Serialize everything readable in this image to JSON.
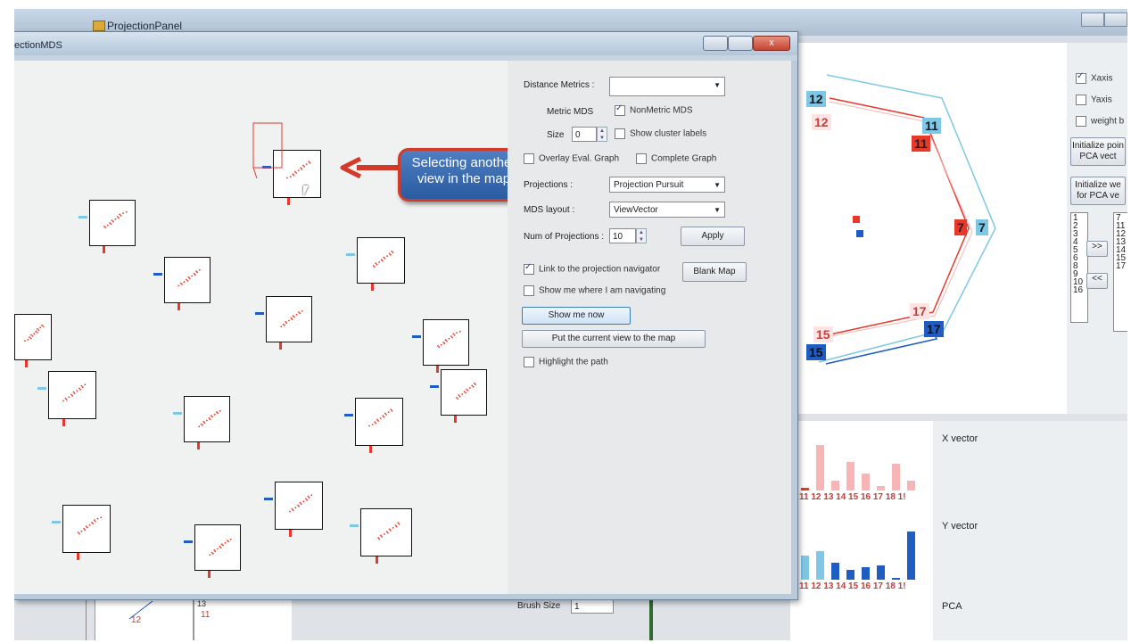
{
  "background_window": {
    "title": "ProjectionPanel"
  },
  "window": {
    "title": "ectionMDS",
    "close_glyph": "x"
  },
  "callout": {
    "text": "Selecting another view in the map"
  },
  "side_panel": {
    "distance_metrics_label": "Distance Metrics :",
    "distance_metrics_value": "",
    "metric_mds_label": "Metric MDS",
    "nonmetric_mds_label": "NonMetric MDS",
    "nonmetric_mds_checked": true,
    "size_label": "Size",
    "size_value": "0",
    "show_cluster_labels_label": "Show cluster labels",
    "overlay_eval_graph_label": "Overlay Eval. Graph",
    "complete_graph_label": "Complete Graph",
    "projections_label": "Projections :",
    "projections_value": "Projection Pursuit",
    "mds_layout_label": "MDS layout :",
    "mds_layout_value": "ViewVector",
    "num_projections_label": "Num of Projections :",
    "num_projections_value": "10",
    "apply_label": "Apply",
    "link_navigator_label": "Link to the projection navigator",
    "link_navigator_checked": true,
    "blank_map_label": "Blank Map",
    "show_me_where_label": "Show me where I am navigating",
    "show_me_now_label": "Show me now",
    "put_current_view_label": "Put the current view to the map",
    "highlight_path_label": "Highlight the path"
  },
  "navigator": {
    "xaxis_label": "Xaxis",
    "xaxis_checked": true,
    "yaxis_label": "Yaxis",
    "weight_label": "weight b",
    "init_points_label": "Initialize poin PCA vect",
    "init_weights_label": "Initialize we for PCA ve",
    "move_right_label": ">>",
    "move_left_label": "<<",
    "left_list": [
      "1",
      "2",
      "3",
      "4",
      "5",
      "6",
      "8",
      "9",
      "10",
      "16"
    ],
    "right_list": [
      "7",
      "11",
      "12",
      "13",
      "14",
      "15",
      "17"
    ],
    "node_labels": {
      "light_12": "12",
      "red_12": "12",
      "light_11": "11",
      "red_11": "11",
      "red_7": "7",
      "light_7": "7",
      "red_17": "17",
      "blue_17": "17",
      "red_15": "15",
      "blue_15": "15"
    }
  },
  "vectors": {
    "x_vector_label": "X vector",
    "y_vector_label": "Y vector",
    "pca_label": "PCA",
    "x_axis_ticks": "11 12 13 14 15 16 17 18 1!",
    "y_axis_ticks": "11 12 13 14 15 16 17 18 1!",
    "x_bars": [
      0.05,
      0.95,
      0.2,
      0.6,
      0.35,
      0.1,
      0.55,
      0.2
    ],
    "y_bars": [
      0.5,
      0.6,
      0.35,
      0.2,
      0.25,
      0.3,
      0.0,
      1.0
    ]
  },
  "bottom_strip": {
    "brush_size_label": "Brush Size",
    "brush_size_value": "1",
    "bottom_12": "12",
    "bottom_11": "11",
    "bottom_13": "13"
  },
  "colors": {
    "accent_red": "#e8382a",
    "accent_blue": "#1f5cc4",
    "light_blue": "#7fc7e6",
    "light_red": "#f7b5b5"
  }
}
